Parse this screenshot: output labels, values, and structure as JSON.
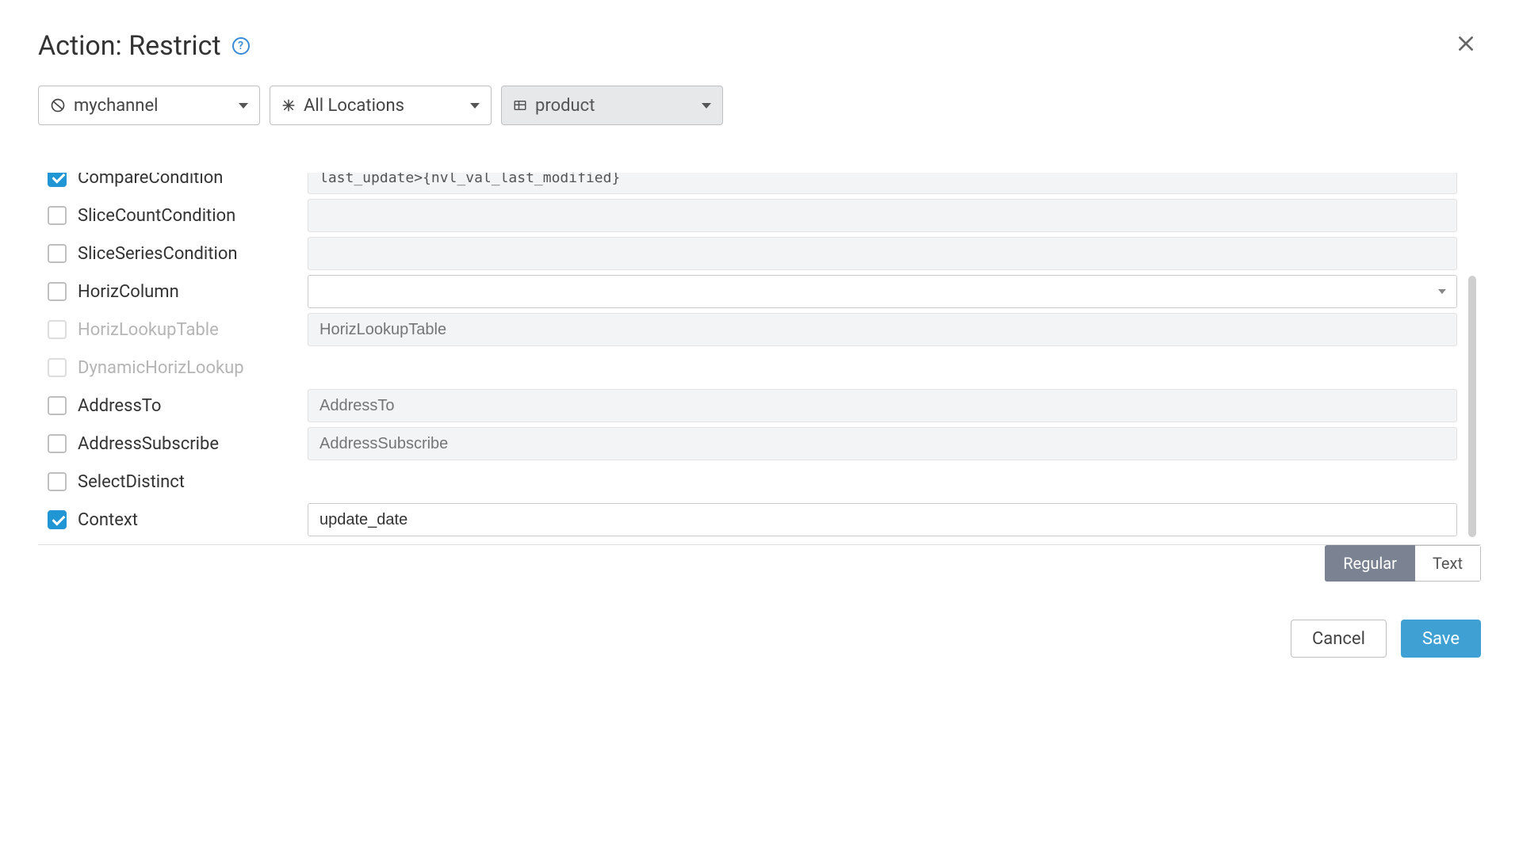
{
  "header": {
    "title": "Action: Restrict"
  },
  "filters": {
    "channel": "mychannel",
    "locations": "All Locations",
    "table": "product"
  },
  "form": {
    "rows": [
      {
        "key": "comparecondition",
        "label": "CompareCondition",
        "checked": true,
        "disabled": false,
        "input": {
          "type": "text",
          "style": "mono",
          "value": "last_update>{nvl_val_last_modified}"
        }
      },
      {
        "key": "slicecount",
        "label": "SliceCountCondition",
        "checked": false,
        "disabled": false,
        "input": {
          "type": "text",
          "style": "readonly",
          "value": ""
        }
      },
      {
        "key": "sliceseries",
        "label": "SliceSeriesCondition",
        "checked": false,
        "disabled": false,
        "input": {
          "type": "text",
          "style": "readonly",
          "value": ""
        }
      },
      {
        "key": "horizcolumn",
        "label": "HorizColumn",
        "checked": false,
        "disabled": false,
        "input": {
          "type": "dropdown",
          "value": ""
        }
      },
      {
        "key": "horizlookuptable",
        "label": "HorizLookupTable",
        "checked": false,
        "disabled": true,
        "input": {
          "type": "text",
          "style": "readonly",
          "placeholder": "HorizLookupTable"
        }
      },
      {
        "key": "dynamichorizlookup",
        "label": "DynamicHorizLookup",
        "checked": false,
        "disabled": true,
        "input": null
      },
      {
        "key": "addressto",
        "label": "AddressTo",
        "checked": false,
        "disabled": false,
        "input": {
          "type": "text",
          "style": "readonly",
          "placeholder": "AddressTo"
        }
      },
      {
        "key": "addresssubscribe",
        "label": "AddressSubscribe",
        "checked": false,
        "disabled": false,
        "input": {
          "type": "text",
          "style": "readonly",
          "placeholder": "AddressSubscribe"
        }
      },
      {
        "key": "selectdistinct",
        "label": "SelectDistinct",
        "checked": false,
        "disabled": false,
        "input": null
      },
      {
        "key": "context",
        "label": "Context",
        "checked": true,
        "disabled": false,
        "input": {
          "type": "text",
          "style": "",
          "value": "update_date"
        }
      }
    ]
  },
  "toggle": {
    "regular": "Regular",
    "text": "Text"
  },
  "footer": {
    "cancel": "Cancel",
    "save": "Save"
  }
}
